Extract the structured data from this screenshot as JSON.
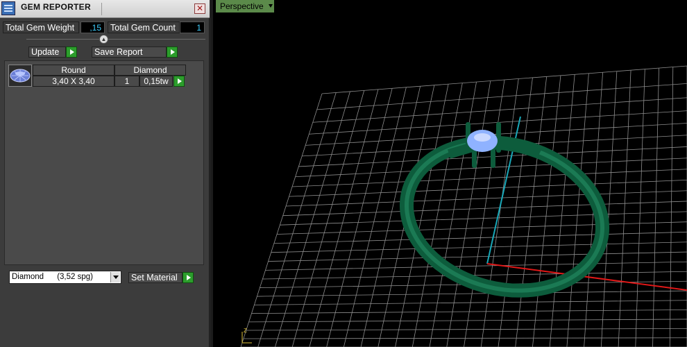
{
  "window": {
    "title": "GEM REPORTER",
    "close_glyph": "✕"
  },
  "stats": {
    "weight_label": "Total Gem Weight",
    "weight_value": ",15",
    "count_label": "Total Gem Count",
    "count_value": "1"
  },
  "actions": {
    "update_label": "Update",
    "save_label": "Save Report"
  },
  "gem_table": {
    "headers": {
      "shape": "Round",
      "material": "Diamond"
    },
    "row": {
      "size": "3,40 X 3,40",
      "count": "1",
      "weight": "0,15tw"
    }
  },
  "material": {
    "selected": "Diamond      (3,52 spg)",
    "set_label": "Set Material"
  },
  "viewport": {
    "view_label": "Perspective",
    "axis_colors": {
      "x": "#e01818",
      "y": "#19a8b8",
      "grid": "#8e8e8e"
    },
    "ring_color": "#0d5c3c",
    "gem_color": "#8fb2ff"
  },
  "icons": [
    "gem-reporter-app-icon",
    "close-icon",
    "collapse-icon",
    "play-arrow-icon",
    "round-gem-icon",
    "dropdown-arrow-icon",
    "axis-gizmo-icon"
  ]
}
